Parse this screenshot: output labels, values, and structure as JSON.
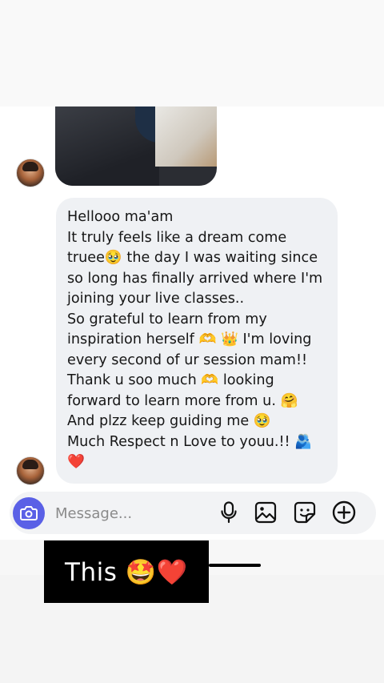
{
  "thread": {
    "message": {
      "lines": [
        "Hellooo ma'am",
        "It truly feels like a dream come",
        "truee🥹 the day I was waiting since",
        "so long has finally arrived where I'm",
        "joining your live classes..",
        "So grateful to learn from my",
        "inspiration herself 🫶 👑 I'm loving",
        "every second of ur session mam!!",
        "Thank u soo much 🫶 looking",
        "forward to learn more from u. 🤗",
        "And plzz keep guiding me 🥹",
        "Much Respect n Love to youu.!! 🫂",
        "❤️"
      ]
    }
  },
  "composer": {
    "placeholder": "Message...",
    "icons": [
      "camera-icon",
      "microphone-icon",
      "gallery-icon",
      "sticker-icon",
      "add-icon"
    ],
    "camera_color": "#5a60e6"
  },
  "caption": {
    "text": "This 🤩❤️"
  }
}
